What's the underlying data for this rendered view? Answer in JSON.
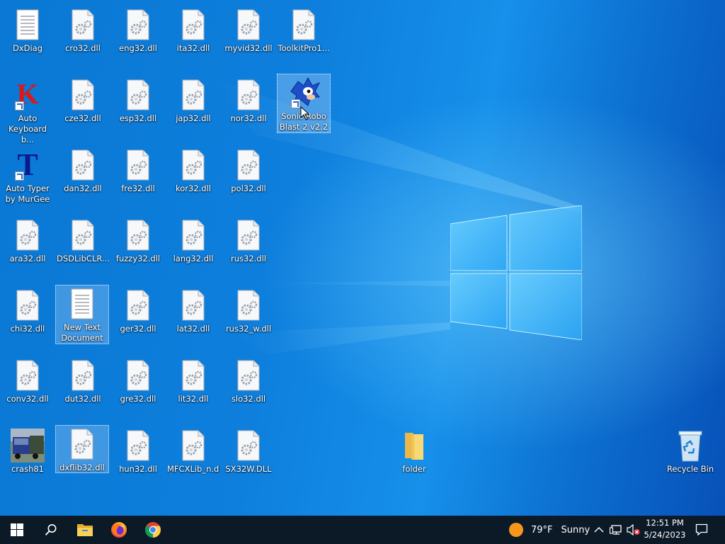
{
  "desktop": {
    "icons": [
      {
        "label": "DxDiag",
        "type": "doc"
      },
      {
        "label": "cro32.dll",
        "type": "dll"
      },
      {
        "label": "eng32.dll",
        "type": "dll"
      },
      {
        "label": "ita32.dll",
        "type": "dll"
      },
      {
        "label": "myvid32.dll",
        "type": "dll"
      },
      {
        "label": "ToolkitPro1...",
        "type": "dll"
      },
      {
        "label": "Auto Keyboard b...",
        "type": "k-app"
      },
      {
        "label": "cze32.dll",
        "type": "dll"
      },
      {
        "label": "esp32.dll",
        "type": "dll"
      },
      {
        "label": "jap32.dll",
        "type": "dll"
      },
      {
        "label": "nor32.dll",
        "type": "dll"
      },
      {
        "label": "Sonic Robo Blast 2 v2.2",
        "type": "sonic"
      },
      {
        "label": "Auto Typer by MurGee",
        "type": "t-app"
      },
      {
        "label": "dan32.dll",
        "type": "dll"
      },
      {
        "label": "fre32.dll",
        "type": "dll"
      },
      {
        "label": "kor32.dll",
        "type": "dll"
      },
      {
        "label": "pol32.dll",
        "type": "dll"
      },
      {
        "label": "ara32.dll",
        "type": "dll"
      },
      {
        "label": "DSDLibCLR....",
        "type": "dll"
      },
      {
        "label": "fuzzy32.dll",
        "type": "dll"
      },
      {
        "label": "lang32.dll",
        "type": "dll"
      },
      {
        "label": "rus32.dll",
        "type": "dll"
      },
      {
        "label": "chi32.dll",
        "type": "dll"
      },
      {
        "label": "New Text Document",
        "type": "doc"
      },
      {
        "label": "ger32.dll",
        "type": "dll"
      },
      {
        "label": "lat32.dll",
        "type": "dll"
      },
      {
        "label": "rus32_w.dll",
        "type": "dll"
      },
      {
        "label": "conv32.dll",
        "type": "dll"
      },
      {
        "label": "dut32.dll",
        "type": "dll"
      },
      {
        "label": "gre32.dll",
        "type": "dll"
      },
      {
        "label": "lit32.dll",
        "type": "dll"
      },
      {
        "label": "slo32.dll",
        "type": "dll"
      },
      {
        "label": "crash81",
        "type": "truck"
      },
      {
        "label": "dxflib32.dll",
        "type": "dll"
      },
      {
        "label": "hun32.dll",
        "type": "dll"
      },
      {
        "label": "MFCXLib_n.dll",
        "type": "dll"
      },
      {
        "label": "SX32W.DLL",
        "type": "dll"
      },
      {
        "label": "folder",
        "type": "folder"
      },
      {
        "label": "Recycle Bin",
        "type": "recycle"
      }
    ]
  },
  "taskbar": {
    "apps": [
      "start-icon",
      "search-icon",
      "file-explorer-icon",
      "firefox-icon",
      "chrome-icon"
    ],
    "weather": {
      "temp": "79°F",
      "condition": "Sunny"
    },
    "clock": {
      "time": "12:51 PM",
      "date": "5/24/2023"
    }
  }
}
